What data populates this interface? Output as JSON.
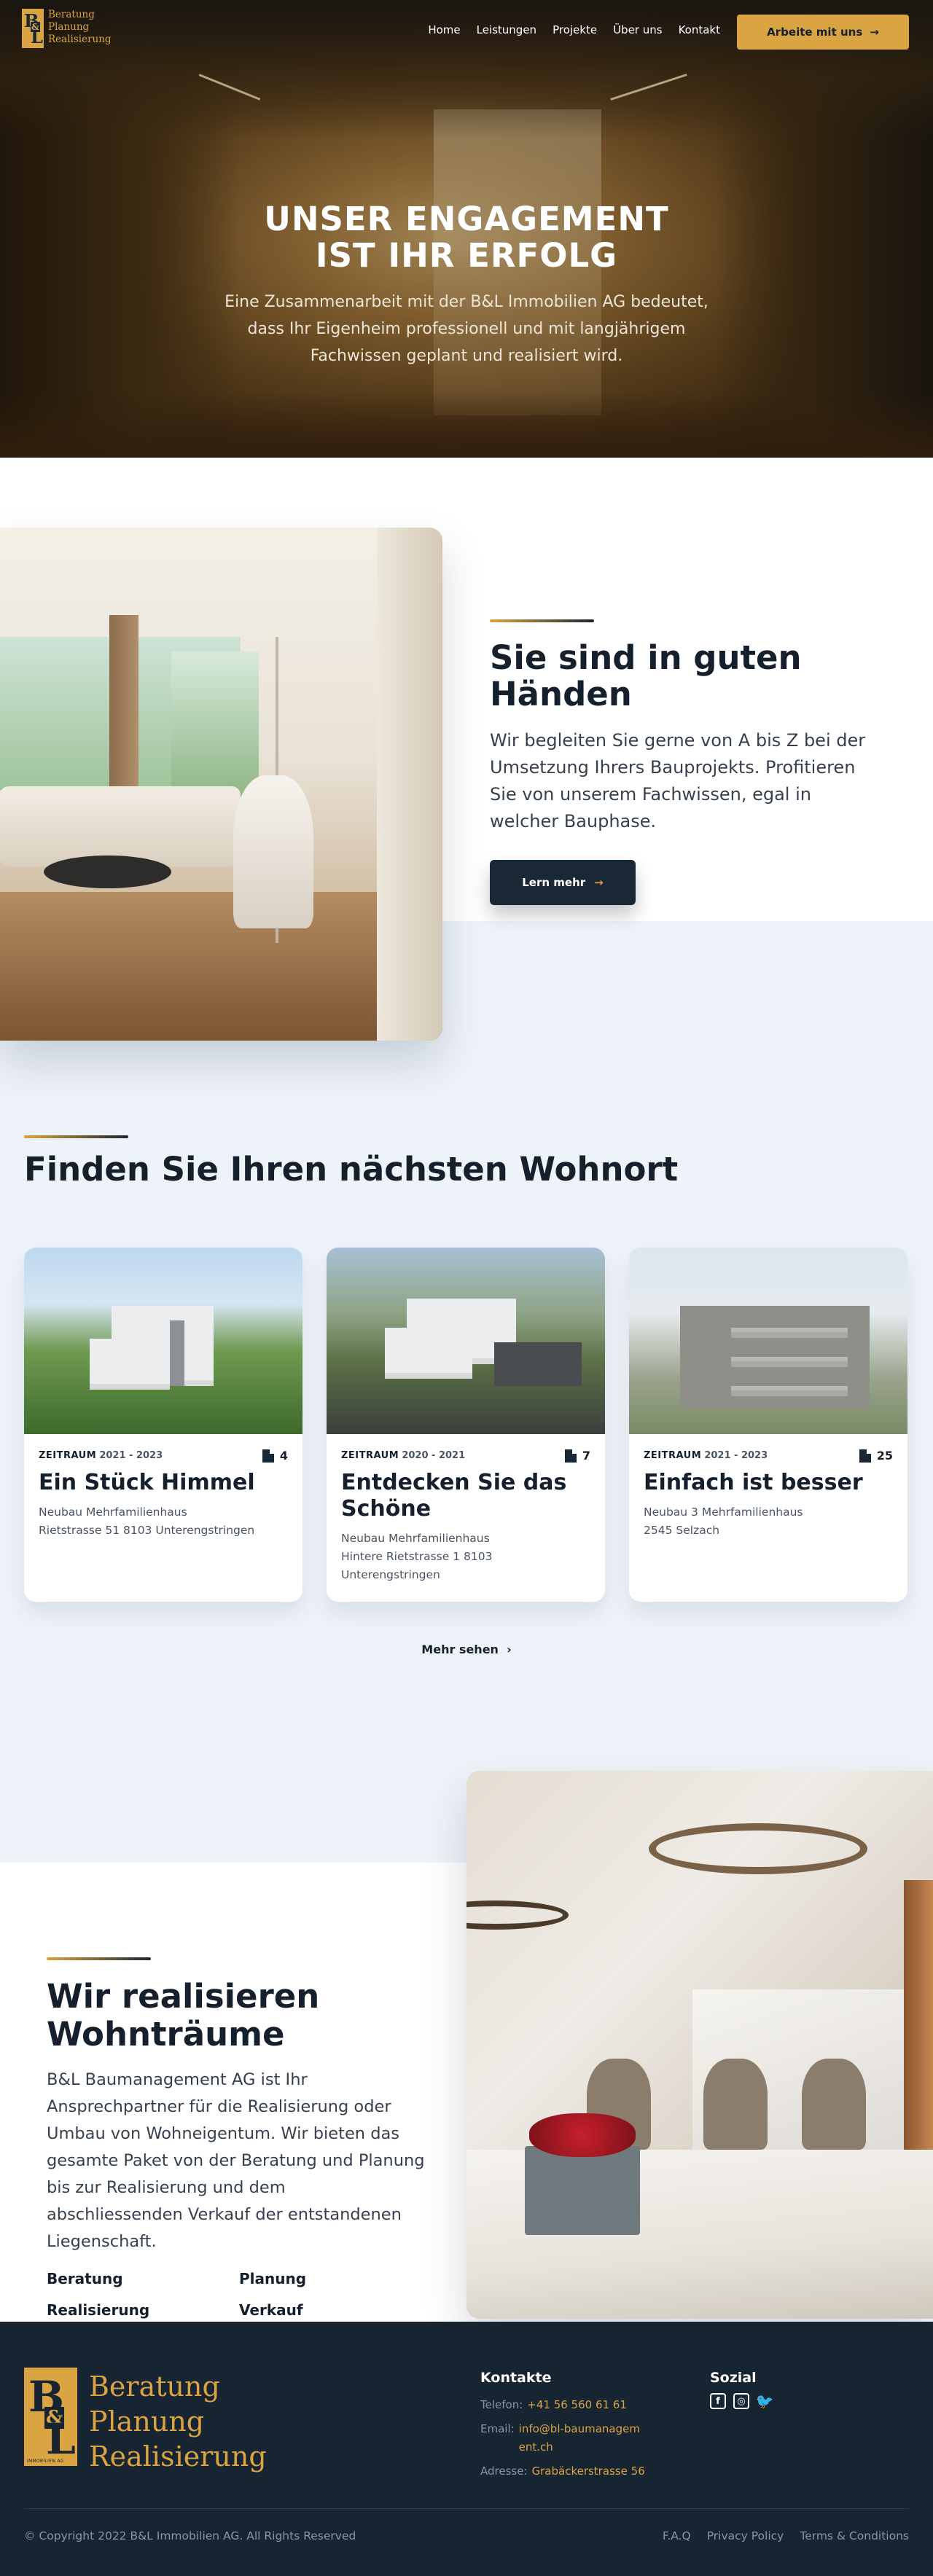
{
  "brand": {
    "logo_mark": "B&L",
    "logo_words": [
      "Beratung",
      "Planung",
      "Realisierung"
    ],
    "logo_subtitle": "IMMOBILIEN AG",
    "gold": "#d9a441",
    "navy": "#172431"
  },
  "nav": {
    "items": [
      "Home",
      "Leistungen",
      "Projekte",
      "Über uns",
      "Kontakt"
    ],
    "cta": "Arbeite mit uns",
    "cta_icon": "arrow-right-icon"
  },
  "hero": {
    "title_line1": "UNSER ENGAGEMENT",
    "title_line2": "IST IHR ERFOLG",
    "subtitle": "Eine Zusammenarbeit mit der B&L Immobilien AG bedeutet, dass Ihr Eigenheim professionell und mit langjährigem Fachwissen geplant und realisiert wird."
  },
  "intro": {
    "heading": "Sie sind in guten Händen",
    "text": "Wir begleiten Sie gerne von A bis Z bei der Umsetzung Ihrers Bauprojekts. Profitieren Sie von unserem Fachwissen, egal in welcher Bauphase.",
    "button": "Lern mehr"
  },
  "projects": {
    "heading": "Finden Sie Ihren nächsten Wohnort",
    "period_label": "ZEITRAUM",
    "cards": [
      {
        "period": "2021 - 2023",
        "count": "4",
        "title": "Ein Stück Himmel",
        "desc": [
          "Neubau Mehrfamilienhaus",
          "Rietstrasse 51 8103 Unterengstringen"
        ]
      },
      {
        "period": "2020 - 2021",
        "count": "7",
        "title": "Entdecken Sie das Schöne",
        "desc": [
          "Neubau Mehrfamilienhaus",
          "Hintere Rietstrasse 1 8103 Unterengstringen"
        ]
      },
      {
        "period": "2021 - 2023",
        "count": "25",
        "title": "Einfach ist besser",
        "desc": [
          "Neubau 3 Mehrfamilienhaus",
          "2545 Selzach"
        ]
      }
    ],
    "more": "Mehr sehen"
  },
  "about": {
    "heading_line1": "Wir realisieren",
    "heading_line2": "Wohnträume",
    "text": "B&L Baumanagement AG ist Ihr Ansprechpartner für die Realisierung oder Umbau von Wohneigentum. Wir bieten das gesamte Paket von der Beratung und Planung bis zur Realisierung und dem abschliessenden Verkauf der entstandenen Liegenschaft.",
    "services": [
      "Beratung",
      "Planung",
      "Realisierung",
      "Verkauf"
    ]
  },
  "footer": {
    "contacts_heading": "Kontakte",
    "phone_label": "Telefon:",
    "phone": "+41 56 560 61 61",
    "email_label": "Email:",
    "email": "info@bl-baumanagement.ch",
    "address_label": "Adresse:",
    "address": "Grabäckerstrasse 56",
    "social_heading": "Sozial",
    "social_icons": [
      "facebook-icon",
      "instagram-icon",
      "twitter-icon"
    ],
    "copyright": "© Copyright 2022 B&L Immobilien AG. All Rights Reserved",
    "links": [
      "F.A.Q",
      "Privacy Policy",
      "Terms & Conditions"
    ]
  }
}
